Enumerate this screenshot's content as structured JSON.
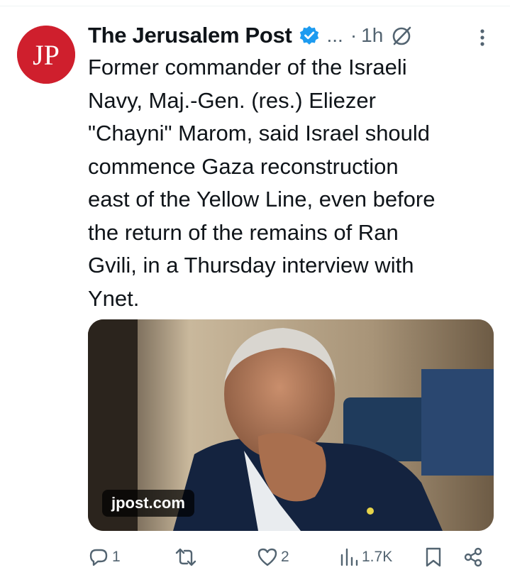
{
  "tweet": {
    "author_name": "The Jerusalem Post",
    "author_handle": "...",
    "separator": "·",
    "time": "1h",
    "text": "Former commander of the Israeli\nNavy, Maj.-Gen. (res.) Eliezer\n\"Chayni\" Marom, said Israel should\ncommence Gaza reconstruction\neast of the Yellow Line, even before\nthe return of the remains of Ran\nGvili, in a Thursday interview with\nYnet.",
    "avatar_text": "JP",
    "media_domain": "jpost.com"
  },
  "actions": {
    "replies": "1",
    "reposts": "",
    "likes": "2",
    "views": "1.7K"
  },
  "icons": {
    "avatar": "jerusalem-post-logo",
    "verified": "verified-badge-icon",
    "grok": "grok-icon",
    "more": "more-vertical-icon",
    "reply": "reply-icon",
    "repost": "repost-icon",
    "like": "heart-icon",
    "views": "views-icon",
    "bookmark": "bookmark-icon",
    "share": "share-icon"
  },
  "colors": {
    "brand_red": "#cf1f2d",
    "verified_blue": "#1d9bf0",
    "secondary_text": "#536471",
    "primary_text": "#0f1419"
  }
}
